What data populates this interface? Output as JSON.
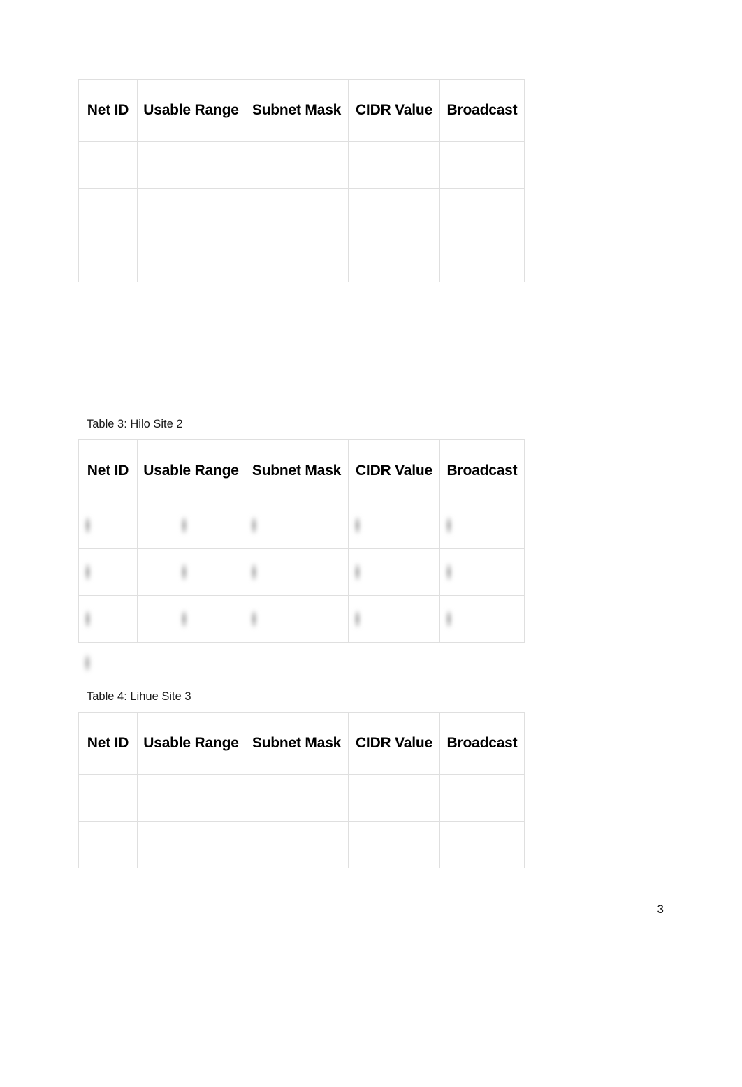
{
  "document": {
    "page_number": "3",
    "column_headers": [
      "Net ID",
      "Usable Range",
      "Subnet Mask",
      "CIDR Value",
      "Broadcast"
    ],
    "tables": [
      {
        "id": "table-2",
        "caption": "",
        "has_caption": false,
        "data_row_count": 3,
        "redacted": false,
        "cells": [
          [
            "",
            "",
            "",
            "",
            ""
          ],
          [
            "",
            "",
            "",
            "",
            ""
          ],
          [
            "",
            "",
            "",
            "",
            ""
          ]
        ]
      },
      {
        "id": "table-3",
        "caption": "Table 3: Hilo Site 2",
        "has_caption": true,
        "data_row_count": 3,
        "redacted": true,
        "cells": [
          [
            "",
            "",
            "",
            "",
            ""
          ],
          [
            "",
            "",
            "",
            "",
            ""
          ],
          [
            "",
            "",
            "",
            "",
            ""
          ]
        ]
      },
      {
        "id": "table-4",
        "caption": "Table 4: Lihue Site 3",
        "has_caption": true,
        "data_row_count": 2,
        "redacted": false,
        "cells": [
          [
            "",
            "",
            "",
            "",
            ""
          ],
          [
            "",
            "",
            "",
            "",
            ""
          ]
        ]
      }
    ]
  },
  "colors": {
    "page_background": "#ffffff",
    "grid_border": "#dfdfdf",
    "header_text": "#000000",
    "caption_text": "#1a1a1a"
  }
}
